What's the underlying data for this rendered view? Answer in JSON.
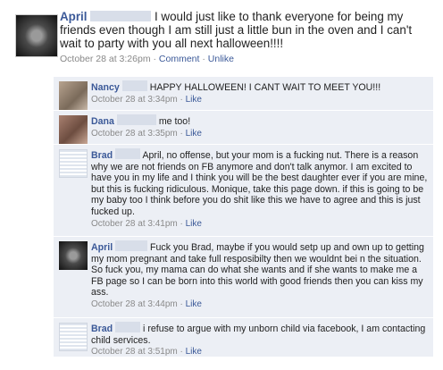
{
  "post": {
    "author": "April",
    "text": "I would just like to thank everyone for being my friends even though I am still just a little bun in the oven and I can't wait to party with you all next halloween!!!!",
    "timestamp": "October 28 at 3:26pm",
    "sep1": " · ",
    "comment_label": "Comment",
    "sep2": " · ",
    "unlike_label": "Unlike"
  },
  "comments": [
    {
      "author": "Nancy",
      "text": "HAPPY HALLOWEEN! I CANT WAIT TO MEET YOU!!!",
      "timestamp": "October 28 at 3:34pm",
      "sep": " · ",
      "like_label": "Like"
    },
    {
      "author": "Dana",
      "text": "me too!",
      "timestamp": "October 28 at 3:35pm",
      "sep": " · ",
      "like_label": "Like"
    },
    {
      "author": "Brad",
      "text": "April, no offense, but your mom is a fucking nut. There is a reason why we are not friends on FB anymore and don't talk anymor. I am excited to have you in my life and I think you will be the best daughter ever if you are mine, but this is fucking ridiculous. Monique, take this page down. if this is going to be my baby too I think before you do shit like this we have to agree and this is just fucked up.",
      "timestamp": "October 28 at 3:41pm",
      "sep": " · ",
      "like_label": "Like"
    },
    {
      "author": "April",
      "text": "Fuck you Brad, maybe if you would setp up and own up to getting my mom pregnant and take full resposibilty then we wouldnt bei n the situation. So fuck you, my mama can do what she wants and if she wants to make me a FB page so I can be born into this world with good friends then you can kiss my ass.",
      "timestamp": "October 28 at 3:44pm",
      "sep": " · ",
      "like_label": "Like"
    },
    {
      "author": "Brad",
      "text": "i refuse to argue with my unborn child via facebook, I am contacting child services.",
      "timestamp": "October 28 at 3:51pm",
      "sep": " · ",
      "like_label": "Like"
    }
  ],
  "colors": {
    "link": "#3b5998",
    "comment_bg": "#eceff5",
    "meta": "#888888"
  }
}
